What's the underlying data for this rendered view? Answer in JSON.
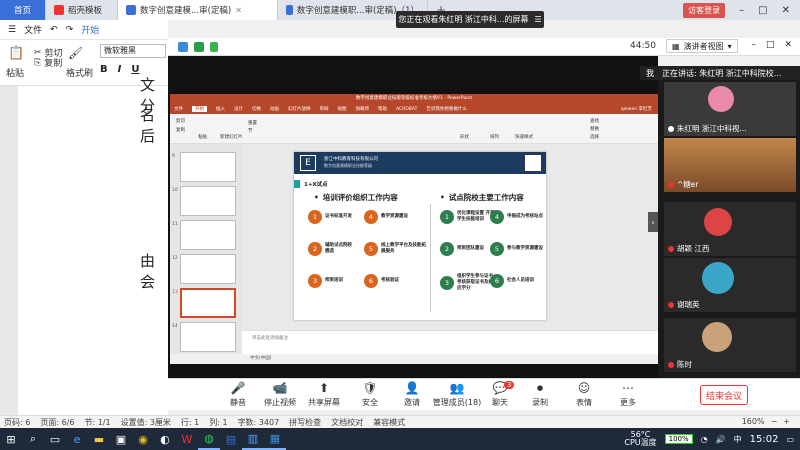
{
  "tabs": [
    {
      "label": "首页",
      "type": "home"
    },
    {
      "label": "稻壳模板",
      "type": "normal"
    },
    {
      "label": "数字创意建模...审(定稿)",
      "type": "active"
    },
    {
      "label": "数字创意建模职...审(定稿)（1）",
      "type": "normal"
    }
  ],
  "window": {
    "visitor": "访客登录",
    "minimize": "–",
    "maximize": "□",
    "close": "✕"
  },
  "banner": {
    "text": "您正在观看朱红明 浙江中科...的屏幕",
    "menu": "☰"
  },
  "wps_menu": {
    "hamburger": "☰",
    "file": "文件",
    "undo": "↶",
    "redo": "↷",
    "start": "开始"
  },
  "wps_tools": {
    "paste": "粘贴",
    "cut": "剪切",
    "copy": "复制",
    "format_painter": "格式刷",
    "font": "微软雅黑",
    "bold": "B",
    "italic": "I",
    "underline": "U"
  },
  "doc_lines": [
    "文分",
    "名后",
    "由会"
  ],
  "meeting_top": {
    "time": "44:50",
    "view": "演讲者视图"
  },
  "speaking": {
    "me": "我",
    "text": "正在讲话: 朱红明 浙江中科院校...",
    "expand": "‹"
  },
  "ppt": {
    "title": "数字创意建模职业技能等级标准考核大纲V1 - PowerPoint",
    "user": "qiewen 李红芳",
    "tabs": [
      "文件",
      "开始",
      "插入",
      "设计",
      "切换",
      "动画",
      "幻灯片放映",
      "审阅",
      "视图",
      "加载项",
      "帮助",
      "ACROBAT",
      "告诉我你想要做什么"
    ],
    "ribbon": [
      "剪切",
      "复制",
      "粘贴",
      "新建幻灯片",
      "重置",
      "节",
      "形状",
      "排列",
      "快速样式",
      "查找",
      "替换",
      "选择"
    ],
    "thumb_numbers": [
      "9",
      "10",
      "11",
      "12",
      "13",
      "14"
    ],
    "notes": "单击此处添加备注",
    "status": "中文(中国)"
  },
  "slide": {
    "org": "浙江中科教育科技有限公司",
    "sub": "数字创意建模职业技能等级",
    "logo": "E",
    "badge": "1+X试点",
    "left_title": "培训评价组织工作内容",
    "right_title": "试点院校主要工作内容",
    "left_items": [
      {
        "n": "1",
        "t": "证书标准开发"
      },
      {
        "n": "2",
        "t": "辅助试点院校遴选"
      },
      {
        "n": "3",
        "t": "师资培训"
      },
      {
        "n": "4",
        "t": "教学资源建设"
      },
      {
        "n": "5",
        "t": "线上教学平台及技能拓展服务"
      },
      {
        "n": "6",
        "t": "考核验证"
      }
    ],
    "right_items": [
      {
        "n": "1",
        "t": "优化课程设置 开展学生技能培训"
      },
      {
        "n": "2",
        "t": "师资团队建设"
      },
      {
        "n": "3",
        "t": "组织学生参与证书考核获取证书及相应学分"
      },
      {
        "n": "4",
        "t": "申报成为考核站点"
      },
      {
        "n": "5",
        "t": "参与教学资源建设"
      },
      {
        "n": "6",
        "t": "社会人员培训"
      }
    ]
  },
  "participants": [
    {
      "name": "朱红明 浙江中科视..."
    },
    {
      "name": "^糖er"
    },
    {
      "name": "胡颖 江西"
    },
    {
      "name": "谢瑞英"
    },
    {
      "name": "陈时"
    }
  ],
  "meeting_bar": [
    {
      "label": "静音",
      "icon": "mic-icon",
      "glyph": "🎤"
    },
    {
      "label": "停止视频",
      "icon": "video-icon",
      "glyph": "📹"
    },
    {
      "label": "共享屏幕",
      "icon": "share-icon",
      "glyph": "⬆"
    },
    {
      "label": "安全",
      "icon": "shield-icon",
      "glyph": "🛡"
    },
    {
      "label": "邀请",
      "icon": "invite-icon",
      "glyph": "👤"
    },
    {
      "label": "管理成员(18)",
      "icon": "members-icon",
      "glyph": "👥"
    },
    {
      "label": "聊天",
      "icon": "chat-icon",
      "glyph": "💬"
    },
    {
      "label": "录制",
      "icon": "record-icon",
      "glyph": "⏺"
    },
    {
      "label": "表情",
      "icon": "emoji-icon",
      "glyph": "☺"
    },
    {
      "label": "更多",
      "icon": "more-icon",
      "glyph": "⋯"
    }
  ],
  "chat_badge": "3",
  "end_meeting": "结束会议",
  "wps_status": {
    "page": "页码: 6",
    "pages": "页面: 6/6",
    "section": "节: 1/1",
    "setting": "设置值: 3厘米",
    "row": "行: 1",
    "col": "列: 1",
    "words": "字数: 3407",
    "spell": "拼写检查",
    "compare": "文档校对",
    "compat": "兼容模式",
    "zoom": "160%"
  },
  "tray": {
    "temp": "56°C",
    "cpu": "CPU温度",
    "battery": "100%",
    "ime": "中",
    "time": "15:02"
  }
}
